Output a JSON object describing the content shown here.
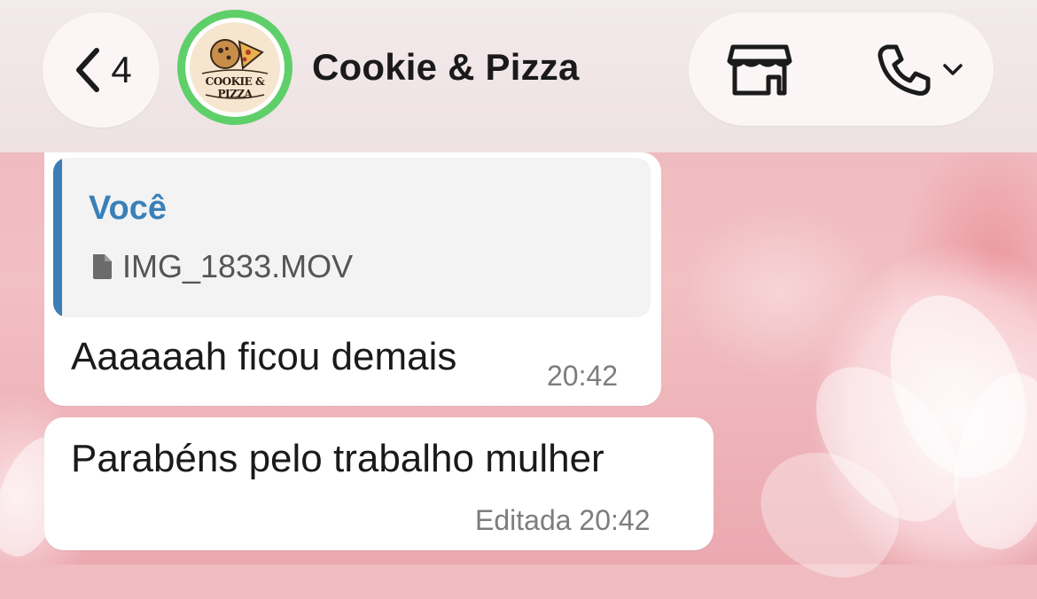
{
  "header": {
    "back_count": "4",
    "chat_title": "Cookie & Pizza",
    "avatar_logo_text": "COOKIE & PIZZA"
  },
  "messages": [
    {
      "quote_author": "Você",
      "quote_file": "IMG_1833.MOV",
      "text": "Aaaaaah ficou demais",
      "time": "20:42"
    },
    {
      "text": "Parabéns pelo trabalho mulher",
      "time": "Editada 20:42"
    }
  ],
  "colors": {
    "accent_quote": "#3d7eb7",
    "avatar_ring": "#5fcf6a"
  },
  "icons": {
    "back": "chevron-left-icon",
    "store": "store-icon",
    "call": "phone-icon",
    "call_menu": "chevron-down-icon",
    "file": "file-icon"
  }
}
